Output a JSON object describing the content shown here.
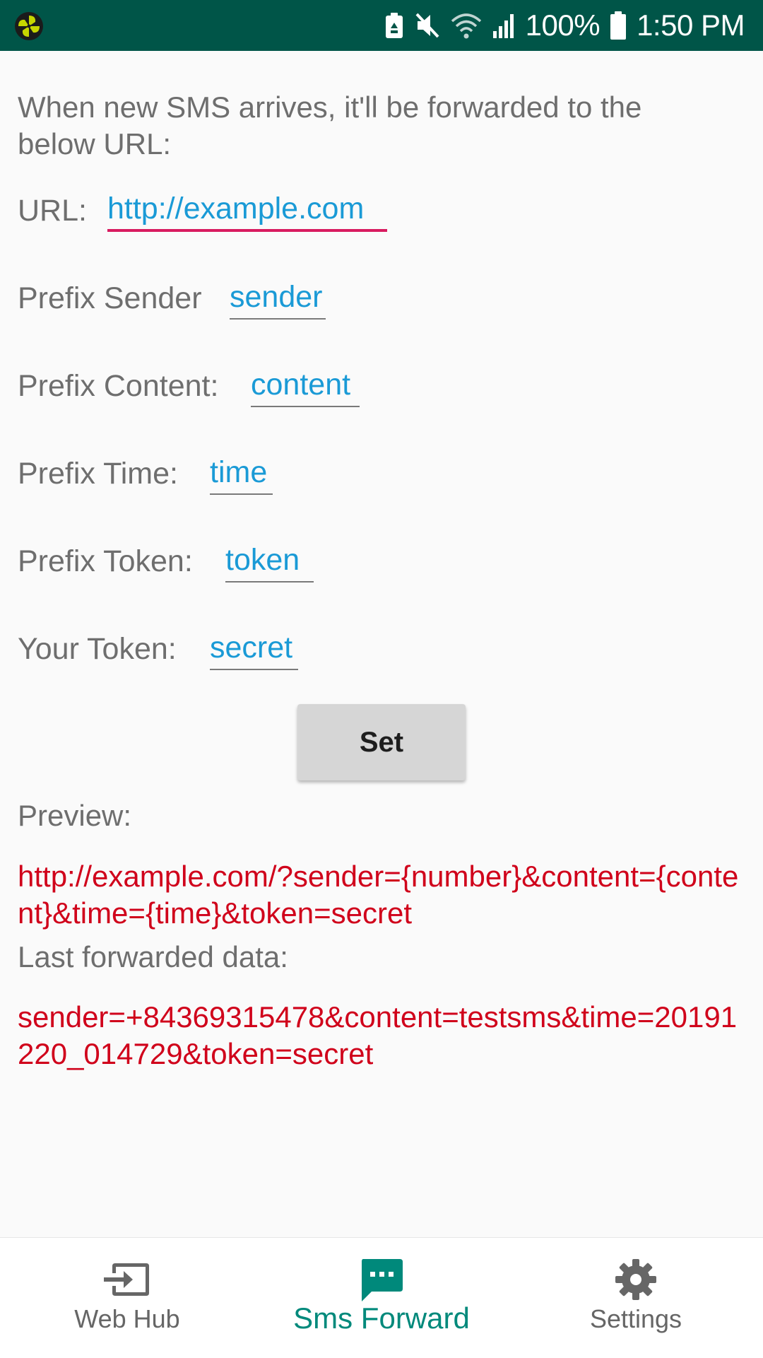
{
  "status_bar": {
    "battery_text": "100%",
    "time": "1:50 PM",
    "icons": [
      "app-pinwheel-icon",
      "recycle-notification-icon",
      "mute-icon",
      "wifi-icon",
      "signal-icon",
      "battery-icon"
    ]
  },
  "intro_text": "When new SMS arrives, it'll be forwarded to the below URL:",
  "fields": {
    "url": {
      "label": "URL:",
      "value": "http://example.com"
    },
    "prefix_sender": {
      "label": "Prefix Sender",
      "value": "sender"
    },
    "prefix_content": {
      "label": "Prefix Content:",
      "value": "content"
    },
    "prefix_time": {
      "label": "Prefix Time:",
      "value": "time"
    },
    "prefix_token": {
      "label": "Prefix Token:",
      "value": "token"
    },
    "your_token": {
      "label": "Your Token:",
      "value": "secret"
    }
  },
  "set_button_label": "Set",
  "preview": {
    "label": "Preview:",
    "value": "http://example.com/?sender={number}&content={content}&time={time}&token=secret"
  },
  "last_forwarded": {
    "label": "Last forwarded data:",
    "value": "sender=+84369315478&content=testsms&time=20191220_014729&token=secret"
  },
  "bottom_nav": {
    "items": [
      {
        "label": "Web Hub",
        "icon": "login-arrow-icon",
        "active": false
      },
      {
        "label": "Sms Forward",
        "icon": "sms-icon",
        "active": true
      },
      {
        "label": "Settings",
        "icon": "gear-icon",
        "active": false
      }
    ]
  },
  "colors": {
    "status_bar": "#005548",
    "accent_input": "#1a9ad6",
    "focus_underline": "#d81b60",
    "result_red": "#d0021b",
    "nav_active": "#00897b"
  }
}
